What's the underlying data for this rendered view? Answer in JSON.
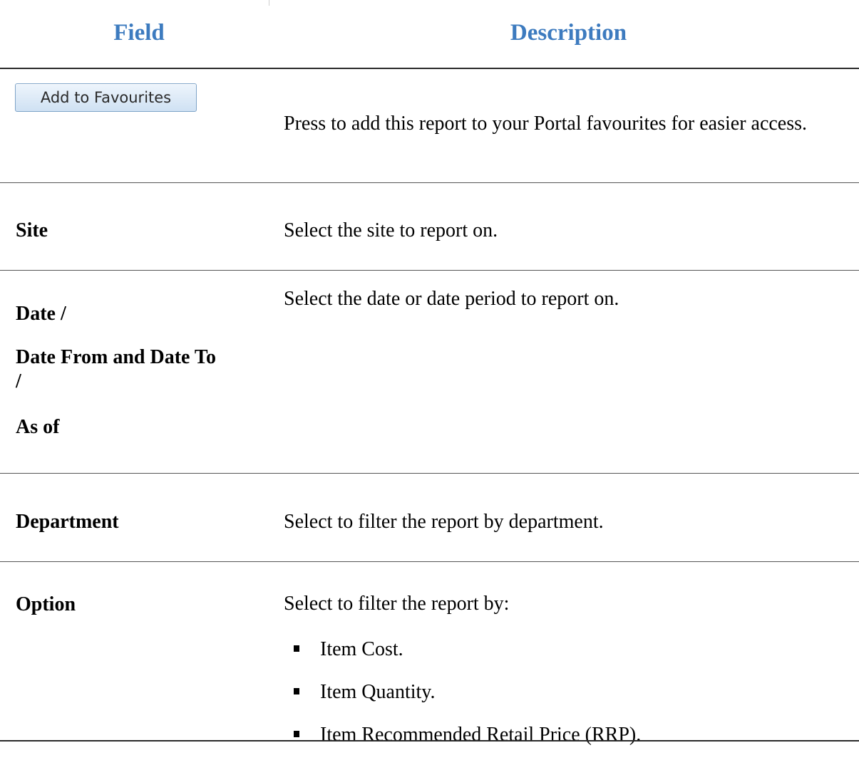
{
  "table": {
    "headers": {
      "field": "Field",
      "description": "Description"
    },
    "rows": [
      {
        "field_button": "Add to Favourites",
        "description": "Press to add this report to your Portal favourites for easier access."
      },
      {
        "field": "Site",
        "description": "Select the site to report on."
      },
      {
        "field_lines": [
          "Date /",
          "Date From and Date To",
          "/",
          "As of"
        ],
        "description": "Select the date or date period to report on."
      },
      {
        "field": "Department",
        "description": "Select to filter the report by department."
      },
      {
        "field": "Option",
        "description": "Select to filter the report by:",
        "options": [
          "Item Cost.",
          "Item Quantity.",
          "Item Recommended Retail Price (RRP)."
        ]
      }
    ]
  },
  "colors": {
    "header_text": "#3d7bbf",
    "rule": "#2a2a2a"
  },
  "icons": {
    "list_bullet": "square-bullet-icon"
  }
}
